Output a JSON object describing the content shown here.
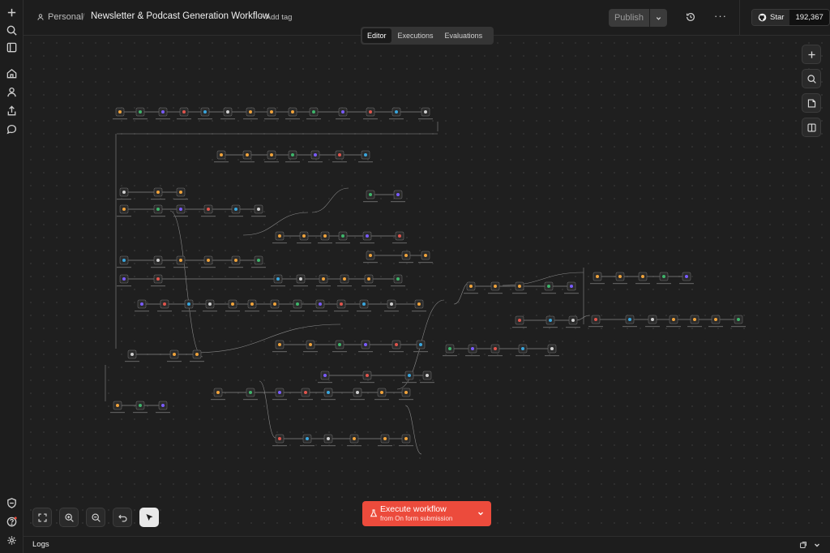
{
  "breadcrumb": {
    "owner": "Personal",
    "separator": "/",
    "workflow_title": "Newsletter & Podcast Generation Workflow",
    "add_tag": "+ Add tag"
  },
  "actions": {
    "publish": "Publish",
    "more": "···"
  },
  "github": {
    "star": "Star",
    "count": "192,367"
  },
  "tabs": [
    {
      "label": "Editor",
      "active": true
    },
    {
      "label": "Executions",
      "active": false
    },
    {
      "label": "Evaluations",
      "active": false
    }
  ],
  "execute": {
    "title": "Execute workflow",
    "subtitle": "from On form submission"
  },
  "logs": {
    "label": "Logs"
  },
  "colors": {
    "accent": "#ec4b3c",
    "canvas": "#1f1f1f",
    "node": "#2b2b2b",
    "connection": "#8a8a8a"
  },
  "icons": {
    "rail": [
      "plus-icon",
      "search-icon",
      "sidebar-icon",
      "home-icon",
      "user-icon",
      "share-icon",
      "chat-icon",
      "shield-icon",
      "help-icon",
      "settings-icon"
    ],
    "right_tools": [
      "add-node-icon",
      "search-nodes-icon",
      "sticky-note-icon",
      "panel-icon"
    ],
    "bottom_tools": [
      "fit-view-icon",
      "zoom-in-icon",
      "zoom-out-icon",
      "undo-icon",
      "select-pointer-icon"
    ]
  }
}
